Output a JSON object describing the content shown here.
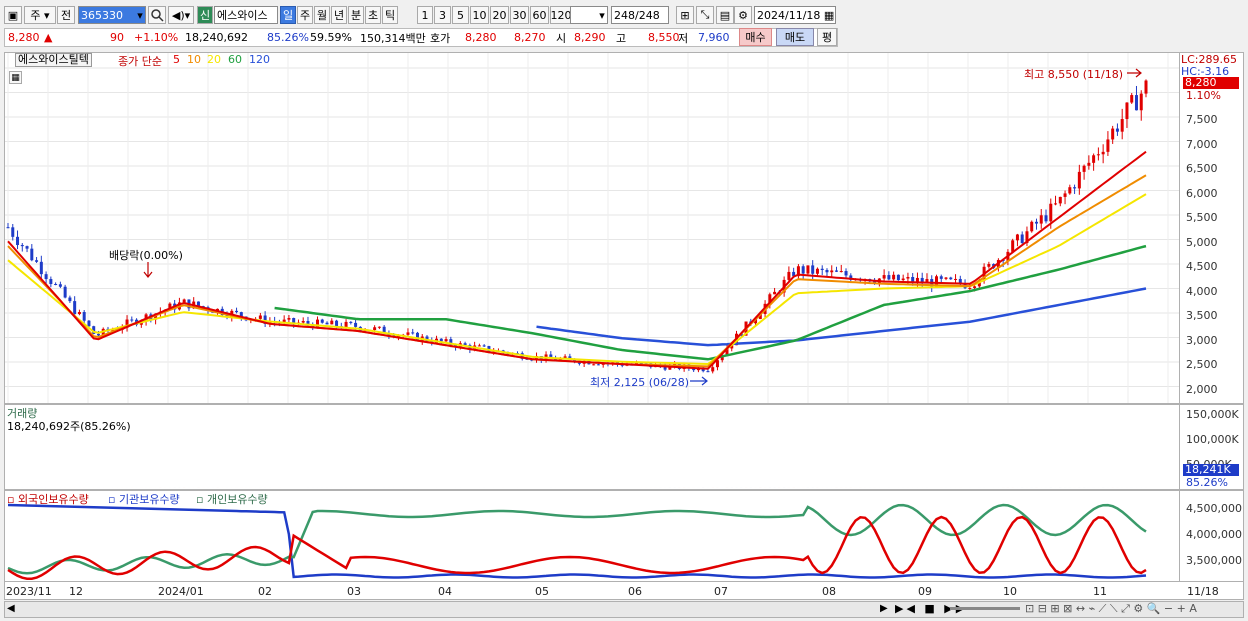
{
  "toolbar": {
    "market": "주",
    "period_type": "전",
    "code": "365330",
    "name_badge": "신",
    "stock_name": "에스와이스",
    "periods": [
      "일",
      "주",
      "월",
      "년",
      "분",
      "초",
      "틱"
    ],
    "active_period": "일",
    "intervals": [
      "1",
      "3",
      "5",
      "10",
      "20",
      "30",
      "60",
      "120"
    ],
    "count": "248",
    "count_total": "/248",
    "date": "2024/11/18"
  },
  "quote": {
    "price": "8,280",
    "arrow": "▲",
    "change": "90",
    "change_pct": "+1.10%",
    "volume": "18,240,692",
    "vol_ratio": "85.26%",
    "turnover": "59.59%",
    "amount": "150,314백만",
    "hoga_label": "호가",
    "ask": "8,280",
    "bid": "8,270",
    "open_label": "시",
    "open": "8,290",
    "high_label": "고",
    "high": "8,550",
    "low_label": "저",
    "low": "7,960",
    "buy_label": "매수",
    "sell_label": "매도",
    "flat_label": "평"
  },
  "legend": {
    "name": "에스와이스틸텍",
    "ma_label": "종가 단순",
    "ma": [
      "5",
      "10",
      "20",
      "60",
      "120"
    ]
  },
  "annotations": {
    "high": "최고 8,550 (11/18)",
    "low": "최저 2,125 (06/28)",
    "dividend": "배당락(0.00%)"
  },
  "price_axis": {
    "lc": "LC:289.65",
    "hc": "HC:-3.16",
    "current": "8,280",
    "pct": "1.10%",
    "ticks": [
      "7,500",
      "7,000",
      "6,500",
      "6,000",
      "5,500",
      "5,000",
      "4,500",
      "4,000",
      "3,500",
      "3,000",
      "2,500",
      "2,000"
    ]
  },
  "volume_panel": {
    "title": "거래량",
    "info": "18,240,692주(85.26%)",
    "ticks": [
      "150,000K",
      "100,000K",
      "50,000K"
    ],
    "current": "18,241K",
    "pct": "85.26%"
  },
  "holdings_panel": {
    "foreign": "외국인보유수량",
    "inst": "기관보유수량",
    "indiv": "개인보유수량",
    "ticks": [
      "4,500,000",
      "4,000,000",
      "3,500,000"
    ]
  },
  "x_axis": {
    "labels": [
      "2023/11",
      "12",
      "2024/01",
      "02",
      "03",
      "04",
      "05",
      "06",
      "07",
      "08",
      "09",
      "10",
      "11",
      "11/18"
    ]
  },
  "colors": {
    "up": "#e00000",
    "down": "#1e3cc8",
    "ma5": "#e00000",
    "ma10": "#f08c00",
    "ma20": "#f5e600",
    "ma60": "#20a040",
    "ma120": "#2850d8",
    "green": "#3a9a6a"
  },
  "chart_data": {
    "type": "candlestick",
    "price_series": {
      "name": "종가",
      "x": [
        "2023/11",
        "12",
        "2024/01",
        "02",
        "03",
        "04",
        "05",
        "06",
        "07",
        "08",
        "09",
        "10",
        "11",
        "11/18"
      ],
      "values": [
        5300,
        3000,
        3700,
        3300,
        3200,
        2850,
        2550,
        2400,
        2300,
        4400,
        4200,
        4100,
        5800,
        8280
      ]
    },
    "ma5": [
      5000,
      2900,
      3700,
      3250,
      3100,
      2800,
      2500,
      2400,
      2300,
      4300,
      4150,
      4100,
      5500,
      6900
    ],
    "ma10": [
      4900,
      2950,
      3650,
      3250,
      3100,
      2800,
      2500,
      2400,
      2350,
      4200,
      4100,
      4050,
      5300,
      6400
    ],
    "ma20": [
      4600,
      3050,
      3500,
      3300,
      3150,
      2850,
      2550,
      2450,
      2400,
      3900,
      4000,
      4050,
      4900,
      6000
    ],
    "ma60": [
      null,
      null,
      null,
      3600,
      3350,
      3350,
      3050,
      2700,
      2500,
      2900,
      3650,
      3950,
      4400,
      4900
    ],
    "ma120": [
      null,
      null,
      null,
      null,
      null,
      null,
      3200,
      2950,
      2800,
      2900,
      3100,
      3300,
      3650,
      4000
    ],
    "ylim": [
      1850,
      8800
    ],
    "volume_K": [
      20,
      8,
      25,
      10,
      8,
      6,
      5,
      5,
      30,
      25,
      15,
      12,
      25,
      18
    ]
  }
}
